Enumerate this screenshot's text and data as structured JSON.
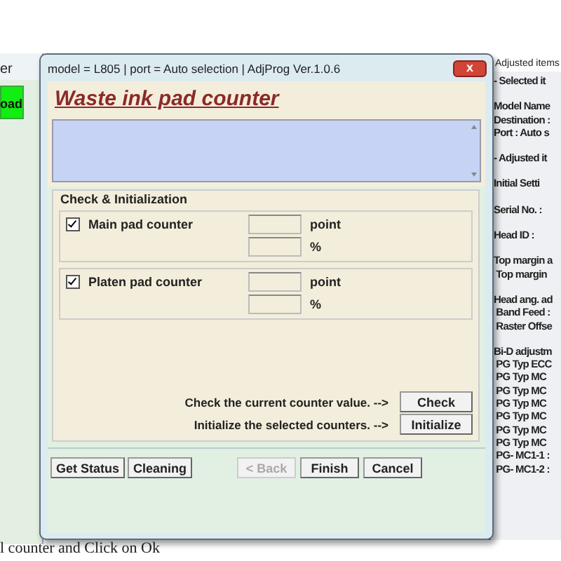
{
  "background_window": {
    "title": "er",
    "button": "oad"
  },
  "dialog": {
    "title": "model = L805 | port = Auto selection | AdjProg Ver.1.0.6",
    "close": "x",
    "heading": "Waste ink pad counter",
    "group_title": "Check & Initialization",
    "counters": [
      {
        "label": "Main pad counter",
        "checked": true,
        "unit_point": "point",
        "unit_percent": "%"
      },
      {
        "label": "Platen pad counter",
        "checked": true,
        "unit_point": "point",
        "unit_percent": "%"
      }
    ],
    "actions": [
      {
        "text": "Check the current counter value. -->",
        "button": "Check"
      },
      {
        "text": "Initialize the selected counters. -->",
        "button": "Initialize"
      }
    ],
    "left_buttons": [
      {
        "label": "Get Status",
        "disabled": false
      },
      {
        "label": "Cleaning",
        "disabled": false
      }
    ],
    "right_buttons": [
      {
        "label": "< Back",
        "disabled": true
      },
      {
        "label": "Finish",
        "disabled": false
      },
      {
        "label": "Cancel",
        "disabled": false
      }
    ]
  },
  "side_panel": {
    "title": "Adjusted items",
    "sections": [
      {
        "lines": [
          "- Selected it"
        ]
      },
      {
        "lines": [
          "Model Name",
          "Destination :",
          "Port : Auto s"
        ]
      },
      {
        "lines": [
          "- Adjusted it"
        ]
      },
      {
        "lines": [
          "Initial Setti"
        ]
      },
      {
        "lines": [
          "Serial No. :"
        ]
      },
      {
        "lines": [
          "Head ID :"
        ]
      },
      {
        "lines": [
          "Top margin a",
          " Top margin"
        ]
      },
      {
        "lines": [
          "Head ang. ad",
          " Band Feed :",
          " Raster Offse"
        ]
      },
      {
        "lines": [
          "Bi-D adjustm",
          " PG Typ ECC",
          " PG Typ MC",
          " PG Typ MC",
          " PG Typ MC",
          " PG Typ MC",
          " PG Typ MC",
          " PG Typ MC",
          " PG- MC1-1 :",
          " PG- MC1-2 :"
        ]
      }
    ]
  },
  "bottom_text": "l counter and Click on Ok"
}
